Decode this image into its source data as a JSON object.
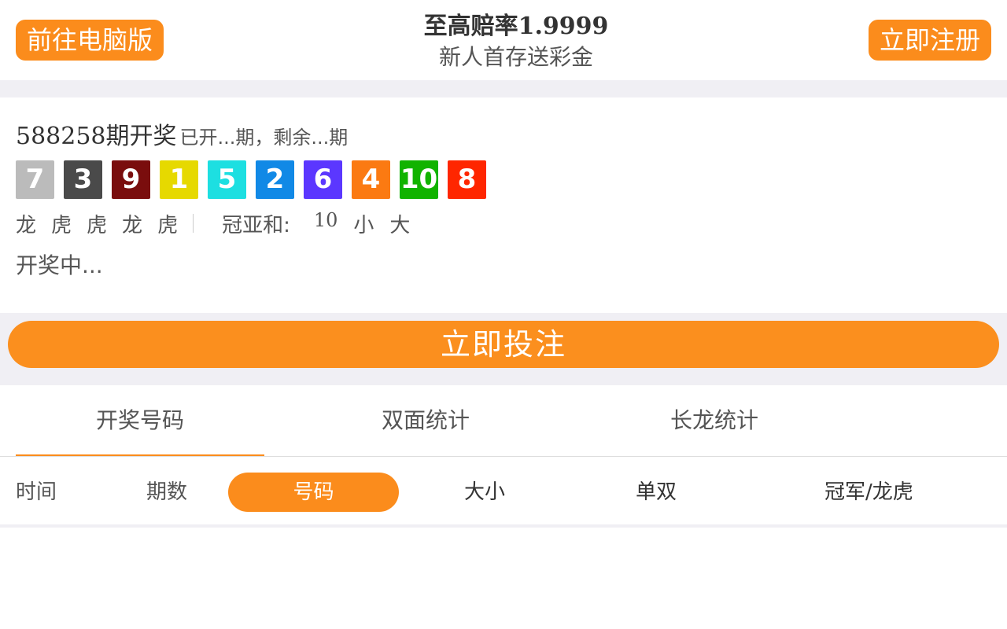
{
  "header": {
    "pc_button": "前往电脑版",
    "title_prefix": "至高赔率",
    "title_odds": "1.9999",
    "subtitle": "新人首存送彩金",
    "register_button": "立即注册"
  },
  "result": {
    "issue_number": "588258",
    "issue_label": "期开奖",
    "remaining_text": "已开...期，剩余...期",
    "balls": [
      {
        "value": "7",
        "color": "#bbbbbb"
      },
      {
        "value": "3",
        "color": "#4a4a4a"
      },
      {
        "value": "9",
        "color": "#7a0d0d"
      },
      {
        "value": "1",
        "color": "#e6d900"
      },
      {
        "value": "5",
        "color": "#1ddfe1"
      },
      {
        "value": "2",
        "color": "#1189e6"
      },
      {
        "value": "6",
        "color": "#5b37ff"
      },
      {
        "value": "4",
        "color": "#fb7a12"
      },
      {
        "value": "10",
        "color": "#11b300"
      },
      {
        "value": "8",
        "color": "#ff2600"
      }
    ],
    "dragon_tiger": [
      "龙",
      "虎",
      "虎",
      "龙",
      "虎"
    ],
    "guanyahe_label": "冠亚和:",
    "guanyahe_value": "10",
    "guanyahe_size": "小",
    "guanyahe_oddeven": "大",
    "status": "开奖中..."
  },
  "bet_button": "立即投注",
  "tabs": [
    {
      "label": "开奖号码",
      "active": true
    },
    {
      "label": "双面统计",
      "active": false
    },
    {
      "label": "长龙统计",
      "active": false
    }
  ],
  "filters": {
    "time": "时间",
    "issue": "期数",
    "number": "号码",
    "size": "大小",
    "oddeven": "单双",
    "champion_dt": "冠军/龙虎"
  },
  "colors": {
    "accent": "#fb8c1c",
    "page_gap": "#f0eff4"
  }
}
